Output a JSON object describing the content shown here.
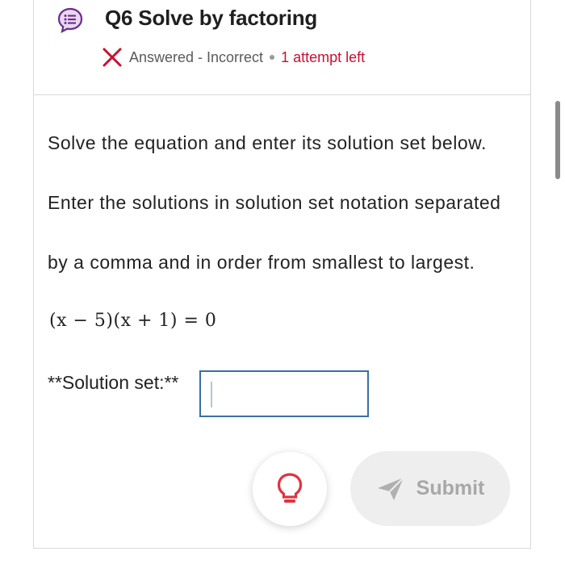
{
  "question": {
    "title": "Q6 Solve by factoring",
    "status": "Answered - Incorrect",
    "attempts": "1 attempt left"
  },
  "instructions": {
    "line1": "Solve the equation and enter its solution set below.",
    "line2": "Enter the solutions in solution set notation separated",
    "line3": "by a comma and in order from smallest to largest."
  },
  "equation": "(x − 5)(x + 1) = 0",
  "answer": {
    "label": "**Solution set:**",
    "value": ""
  },
  "actions": {
    "submit_label": "Submit"
  },
  "icons": {
    "question": "question-list-icon",
    "status": "incorrect-x-icon",
    "hint": "lightbulb-icon",
    "submit": "send-icon"
  },
  "colors": {
    "accent_purple": "#6b2d8a",
    "incorrect_red": "#c8102e",
    "input_border": "#3a6ea5",
    "submit_disabled": "#eeeeee"
  }
}
